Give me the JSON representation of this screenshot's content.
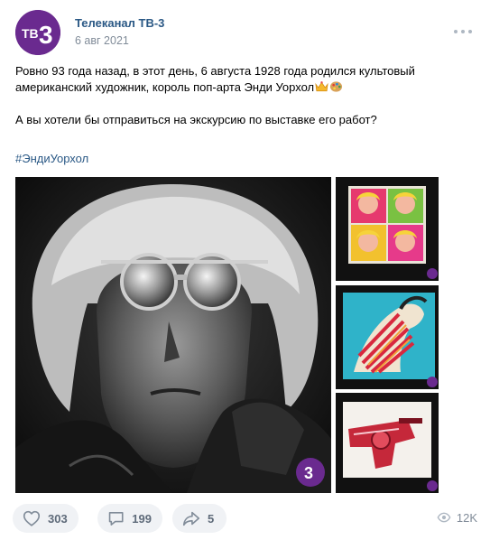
{
  "post": {
    "author": "Телеканал ТВ-3",
    "date": "6 авг 2021",
    "avatar_text": "ТВ3",
    "text_line1": "Ровно 93 года назад, в этот день, 6 августа 1928 года родился культовый",
    "text_line2": "американский художник, король поп-арта Энди Уорхол",
    "text_line3": "А вы хотели бы отправиться на экскурсию по выставке его работ?",
    "hashtag": "#ЭндиУорхол",
    "watermark": "3"
  },
  "actions": {
    "likes": "303",
    "comments": "199",
    "shares": "5",
    "views": "12K"
  },
  "colors": {
    "link": "#2a5885",
    "brand": "#6a2a8f",
    "muted": "#818c99",
    "button_bg": "#f0f2f5"
  },
  "icons": {
    "more": "more-horizontal-icon",
    "like": "heart-icon",
    "comment": "comment-bubble-icon",
    "share": "share-arrow-icon",
    "views": "eye-icon"
  }
}
